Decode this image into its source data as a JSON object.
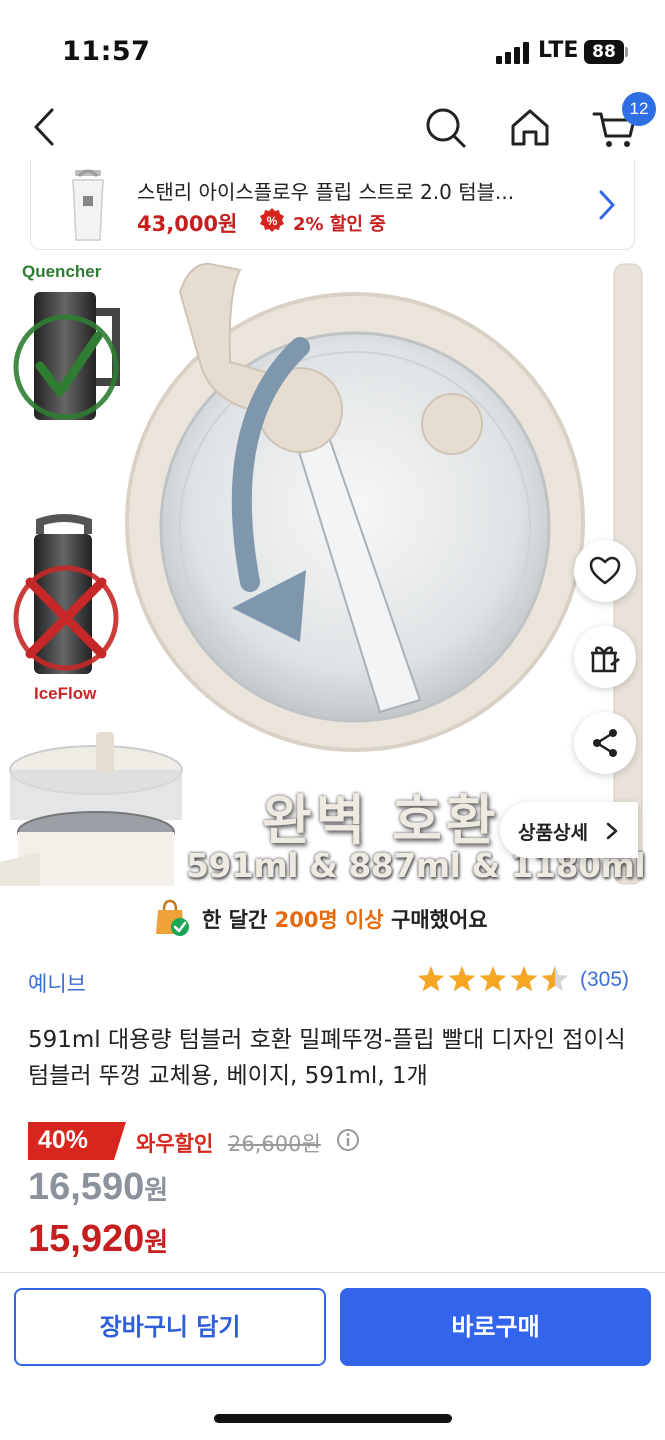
{
  "status_bar": {
    "time": "11:57",
    "network": "LTE",
    "battery": "88"
  },
  "nav": {
    "cart_count": "12"
  },
  "mini_card": {
    "title": "스탠리 아이스플로우 플립 스트로 2.0 텀블...",
    "price": "43,000원",
    "sale_text": "2% 할인 중"
  },
  "hero": {
    "label_top": "Quencher",
    "label_bottom": "IceFlow",
    "headline": "완벽 호환",
    "subline": "591ml & 887ml & 1180ml",
    "detail_button": "상품상세"
  },
  "purchase_stat": {
    "prefix": "한 달간 ",
    "highlight": "200명 이상",
    "suffix": " 구매했어요"
  },
  "seller": "예니브",
  "rating": {
    "stars": 4.5,
    "count": "(305)"
  },
  "product_title": "591ml 대용량 텀블러 호환 밀폐뚜껑-플립 빨대 디자인 접이식 텀블러 뚜껑 교체용, 베이지, 591ml, 1개",
  "pricing": {
    "discount_percent": "40%",
    "wow_label": "와우할인",
    "original_price": "26,600원",
    "member_price": "16,590",
    "final_price": "15,920",
    "currency": "원"
  },
  "actions": {
    "add_to_cart": "장바구니 담기",
    "buy_now": "바로구매"
  },
  "colors": {
    "accent_blue": "#3264ec",
    "price_red": "#c51f1f",
    "highlight_orange": "#e56a0c"
  }
}
